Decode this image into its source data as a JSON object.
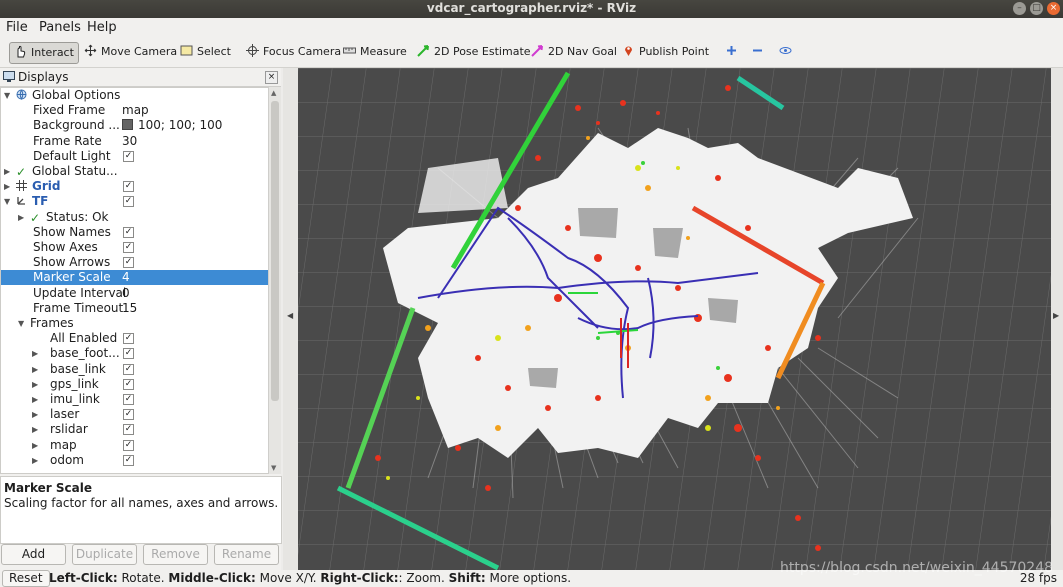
{
  "window": {
    "title": "vdcar_cartographer.rviz* - RViz"
  },
  "menu": [
    "File",
    "Panels",
    "Help"
  ],
  "toolbar": {
    "interact": "Interact",
    "move_camera": "Move Camera",
    "select": "Select",
    "focus_camera": "Focus Camera",
    "measure": "Measure",
    "pose_estimate": "2D Pose Estimate",
    "nav_goal": "2D Nav Goal",
    "publish_point": "Publish Point"
  },
  "displays": {
    "title": "Displays",
    "rows": [
      {
        "label": "Global Options",
        "value": "",
        "check": false,
        "indent": 0,
        "expander": "open",
        "icon": "globe-icon"
      },
      {
        "label": "Fixed Frame",
        "value": "map",
        "check": false,
        "indent": 1
      },
      {
        "label": "Background ...",
        "value": "100; 100; 100",
        "check": false,
        "indent": 1,
        "swatch": "#646464"
      },
      {
        "label": "Frame Rate",
        "value": "30",
        "check": false,
        "indent": 1
      },
      {
        "label": "Default Light",
        "value": "",
        "check": true,
        "indent": 1
      },
      {
        "label": "Global Statu...",
        "value": "",
        "check": false,
        "indent": 0,
        "expander": "closed",
        "icon": "status-ok-icon"
      },
      {
        "label": "Grid",
        "value": "",
        "check": true,
        "indent": 0,
        "expander": "closed",
        "icon": "grid-icon",
        "blue": true
      },
      {
        "label": "TF",
        "value": "",
        "check": true,
        "indent": 0,
        "expander": "open",
        "icon": "tf-icon",
        "blue": true
      },
      {
        "label": "Status: Ok",
        "value": "",
        "check": false,
        "indent": 1,
        "expander": "closed",
        "icon": "status-ok-icon"
      },
      {
        "label": "Show Names",
        "value": "",
        "check": true,
        "indent": 1
      },
      {
        "label": "Show Axes",
        "value": "",
        "check": true,
        "indent": 1
      },
      {
        "label": "Show Arrows",
        "value": "",
        "check": true,
        "indent": 1
      },
      {
        "label": "Marker Scale",
        "value": "4",
        "check": false,
        "indent": 1,
        "selected": true
      },
      {
        "label": "Update Interval",
        "value": "0",
        "check": false,
        "indent": 1
      },
      {
        "label": "Frame Timeout",
        "value": "15",
        "check": false,
        "indent": 1
      },
      {
        "label": "Frames",
        "value": "",
        "check": false,
        "indent": 1,
        "expander": "open"
      },
      {
        "label": "All Enabled",
        "value": "",
        "check": true,
        "indent": 2
      },
      {
        "label": "base_foot...",
        "value": "",
        "check": true,
        "indent": 2,
        "expander": "closed"
      },
      {
        "label": "base_link",
        "value": "",
        "check": true,
        "indent": 2,
        "expander": "closed"
      },
      {
        "label": "gps_link",
        "value": "",
        "check": true,
        "indent": 2,
        "expander": "closed"
      },
      {
        "label": "imu_link",
        "value": "",
        "check": true,
        "indent": 2,
        "expander": "closed"
      },
      {
        "label": "laser",
        "value": "",
        "check": true,
        "indent": 2,
        "expander": "closed"
      },
      {
        "label": "rslidar",
        "value": "",
        "check": true,
        "indent": 2,
        "expander": "closed"
      },
      {
        "label": "map",
        "value": "",
        "check": true,
        "indent": 2,
        "expander": "closed"
      },
      {
        "label": "odom",
        "value": "",
        "check": true,
        "indent": 2,
        "expander": "closed"
      }
    ],
    "description": {
      "heading": "Marker Scale",
      "text": "Scaling factor for all names, axes and arrows."
    },
    "buttons": {
      "add": "Add",
      "duplicate": "Duplicate",
      "remove": "Remove",
      "rename": "Rename"
    }
  },
  "status": {
    "reset": "Reset",
    "left_click": "Left-Click:",
    "left_action": " Rotate. ",
    "middle_click": "Middle-Click:",
    "middle_action": " Move X/Y. ",
    "right_click": "Right-Click:",
    "right_action": ": Zoom. ",
    "shift": "Shift:",
    "shift_action": " More options.",
    "fps": "28 fps"
  },
  "watermark": "https://blog.csdn.net/weixin_44570248",
  "colors": {
    "selection": "#3d8bd4",
    "background": "#646464",
    "path": "#3a2fb4"
  }
}
